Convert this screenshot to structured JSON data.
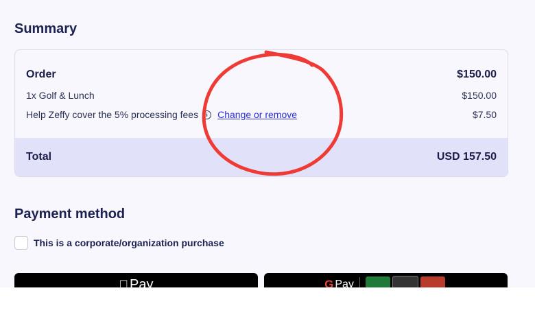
{
  "summary": {
    "title": "Summary",
    "order_label": "Order",
    "order_amount": "$150.00",
    "item_label": "1x Golf & Lunch",
    "item_amount": "$150.00",
    "fee_label": "Help Zeffy cover the 5% processing fees",
    "fee_link": "Change or remove",
    "fee_amount": "$7.50",
    "total_label": "Total",
    "total_amount": "USD 157.50"
  },
  "payment": {
    "title": "Payment method",
    "corporate_label": "This is a corporate/organization purchase",
    "apple_pay_label": "Pay",
    "google_pay_label": "Pay"
  },
  "icons": {
    "info": "info-icon",
    "apple": "apple-icon",
    "google": "google-icon"
  },
  "colors": {
    "link": "#2f2fd6",
    "total_band": "#e2e1fa",
    "annotation_circle": "#ef3b36"
  }
}
